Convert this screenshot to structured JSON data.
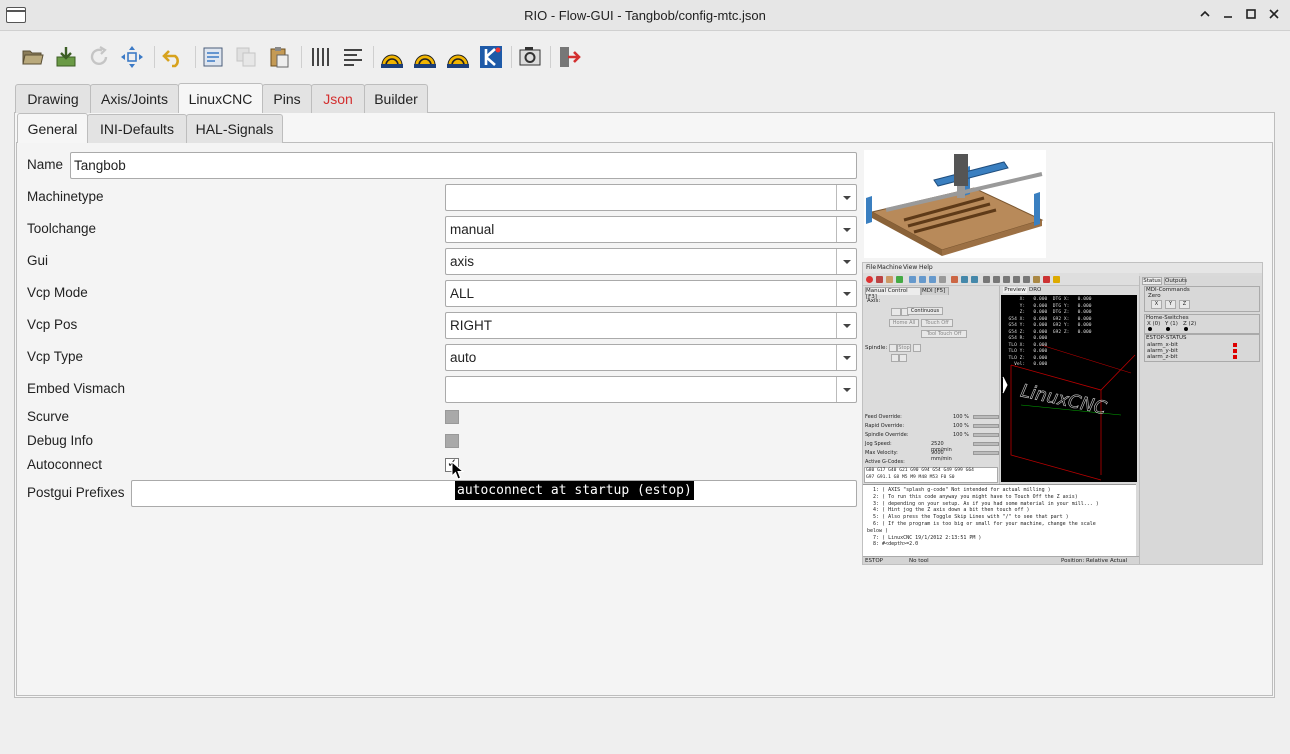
{
  "window": {
    "title": "RIO - Flow-GUI - Tangbob/config-mtc.json",
    "controls": [
      "chevron-up",
      "minimize",
      "maximize",
      "close"
    ]
  },
  "toolbar": {
    "buttons": [
      {
        "name": "open",
        "icon": "folder-open-icon",
        "enabled": true
      },
      {
        "name": "save",
        "icon": "save-download-icon",
        "enabled": true
      },
      {
        "name": "reload",
        "icon": "reload-icon",
        "enabled": false
      },
      {
        "name": "fit-view",
        "icon": "fit-arrows-icon",
        "enabled": true
      },
      {
        "name": "undo",
        "icon": "undo-icon",
        "enabled": true
      },
      {
        "name": "export",
        "icon": "export-icon",
        "enabled": true
      },
      {
        "name": "copy",
        "icon": "copy-icon",
        "enabled": false
      },
      {
        "name": "paste",
        "icon": "paste-icon",
        "enabled": true
      },
      {
        "name": "distribute",
        "icon": "distribute-icon",
        "enabled": true
      },
      {
        "name": "align",
        "icon": "align-left-icon",
        "enabled": true
      },
      {
        "name": "linuxcnc-1",
        "icon": "linuxcnc-icon",
        "enabled": true
      },
      {
        "name": "linuxcnc-2",
        "icon": "linuxcnc-icon",
        "enabled": true
      },
      {
        "name": "linuxcnc-3",
        "icon": "linuxcnc-icon",
        "enabled": true
      },
      {
        "name": "kicad",
        "icon": "kicad-icon",
        "enabled": true
      },
      {
        "name": "screenshot",
        "icon": "screenshot-icon",
        "enabled": true
      },
      {
        "name": "exit",
        "icon": "exit-icon",
        "enabled": true
      }
    ]
  },
  "tabs": {
    "top": [
      {
        "label": "Drawing",
        "active": false
      },
      {
        "label": "Axis/Joints",
        "active": false
      },
      {
        "label": "LinuxCNC",
        "active": true
      },
      {
        "label": "Pins",
        "active": false
      },
      {
        "label": "Json",
        "active": false,
        "color": "#d32f2f"
      },
      {
        "label": "Builder",
        "active": false
      }
    ],
    "sub": [
      {
        "label": "General",
        "active": true
      },
      {
        "label": "INI-Defaults",
        "active": false
      },
      {
        "label": "HAL-Signals",
        "active": false
      }
    ]
  },
  "form": {
    "name": {
      "label": "Name",
      "value": "Tangbob"
    },
    "machinetype": {
      "label": "Machinetype",
      "value": ""
    },
    "toolchange": {
      "label": "Toolchange",
      "value": "manual"
    },
    "gui": {
      "label": "Gui",
      "value": "axis"
    },
    "vcp_mode": {
      "label": "Vcp Mode",
      "value": "ALL"
    },
    "vcp_pos": {
      "label": "Vcp Pos",
      "value": "RIGHT"
    },
    "vcp_type": {
      "label": "Vcp Type",
      "value": "auto"
    },
    "embed_vismach": {
      "label": "Embed Vismach",
      "value": ""
    },
    "scurve": {
      "label": "Scurve",
      "checked": false
    },
    "debug_info": {
      "label": "Debug Info",
      "checked": false
    },
    "autoconnect": {
      "label": "Autoconnect",
      "checked": true
    },
    "postgui_prefixes": {
      "label": "Postgui Prefixes",
      "value": ""
    }
  },
  "tooltip": "autoconnect at startup (estop)",
  "preview": {
    "menu": [
      "File",
      "Machine",
      "View",
      "Help"
    ],
    "left_tabs": [
      "Manual Control [F3]",
      "MDI [F5]"
    ],
    "axis_label": "Axis:",
    "jog_mode": "Continuous",
    "buttons": [
      "Home All",
      "Touch Off",
      "Tool Touch Off"
    ],
    "spindle_label": "Spindle:",
    "stop_label": "Stop",
    "overrides": [
      {
        "label": "Feed Override:",
        "value": "100 %"
      },
      {
        "label": "Rapid Override:",
        "value": "100 %"
      },
      {
        "label": "Spindle Override:",
        "value": "100 %"
      },
      {
        "label": "Jog Speed:",
        "value": "2520 mm/min"
      },
      {
        "label": "Max Velocity:",
        "value": "9000 mm/min"
      }
    ],
    "active_gcodes_label": "Active G-Codes:",
    "active_gcodes": "G80 G17 G40 G21 G90 G94 G54 G49 G99 G64\nG97 G91.1 G8 M5 M9 M48 M53 F0 S0",
    "center_tabs": [
      "Preview",
      "DRO"
    ],
    "dro": "      X:   0.000  DTG X:   0.000\n      Y:   0.000  DTG Y:   0.000\n      Z:   0.000  DTG Z:   0.000\n  G54 X:   0.000  G92 X:   0.000\n  G54 Y:   0.000  G92 Y:   0.000\n  G54 Z:   0.000  G92 Z:   0.000\n  G54 R:   0.000\n  TLO X:   0.000\n  TLO Y:   0.000\n  TLO Z:   0.000\n    Vel:   0.000",
    "canvas_text": "LinuxCNC",
    "gcode_lines": "  1: ( AXIS \"splash g-code\" Not intended for actual milling )\n  2: ( To run this code anyway you might have to Touch Off the Z axis)\n  3: ( depending on your setup. As if you had some material in your mill... )\n  4: ( Hint jog the Z axis down a bit then touch off )\n  5: ( Also press the Toggle Skip Lines with \"/\" to see that part )\n  6: ( If the program is too big or small for your machine, change the scale\nbelow )\n  7: ( LinuxCNC 19/1/2012 2:13:51 PM )\n  8: #<depth>=2.0",
    "statusbar": [
      "ESTOP",
      "No tool",
      "Position: Relative Actual"
    ],
    "right_tabs": [
      "Status",
      "Outputs"
    ],
    "mdi_label": "MDI-Commands",
    "zero_label": "Zero",
    "zero_buttons": [
      "X",
      "Y",
      "Z"
    ],
    "home_label": "Home-Switches",
    "home_axes": [
      "X (0)",
      "Y (1)",
      "Z (2)"
    ],
    "estop_label": "ESTOP-STATUS",
    "alarms": [
      "alarm_x-bit",
      "alarm_y-bit",
      "alarm_z-bit"
    ]
  }
}
